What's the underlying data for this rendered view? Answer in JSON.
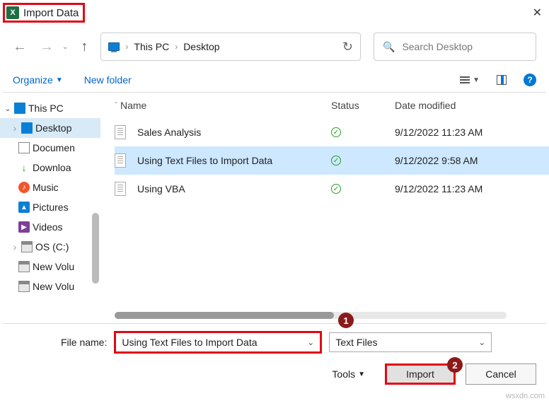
{
  "title": "Import Data",
  "breadcrumb": {
    "pc": "This PC",
    "loc": "Desktop"
  },
  "search": {
    "placeholder": "Search Desktop"
  },
  "toolbar": {
    "organize": "Organize",
    "newfolder": "New folder"
  },
  "columns": {
    "name": "Name",
    "status": "Status",
    "date": "Date modified"
  },
  "tree": {
    "thispc": "This PC",
    "desktop": "Desktop",
    "documents": "Documen",
    "downloads": "Downloa",
    "music": "Music",
    "pictures": "Pictures",
    "videos": "Videos",
    "osc": "OS (C:)",
    "nv1": "New Volu",
    "nv2": "New Volu"
  },
  "files": [
    {
      "name": "Sales Analysis",
      "date": "9/12/2022 11:23 AM"
    },
    {
      "name": "Using Text Files to Import Data",
      "date": "9/12/2022 9:58 AM"
    },
    {
      "name": "Using VBA",
      "date": "9/12/2022 11:23 AM"
    }
  ],
  "bottom": {
    "filename_label": "File name:",
    "filename_value": "Using Text Files to Import Data",
    "filter": "Text Files",
    "tools": "Tools",
    "import": "Import",
    "cancel": "Cancel"
  },
  "watermark": "wsxdn.com"
}
